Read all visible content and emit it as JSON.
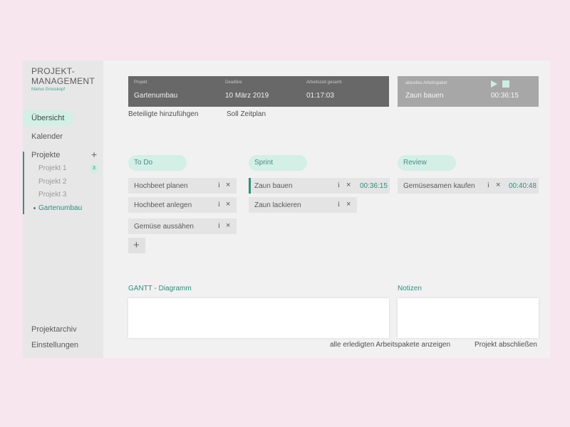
{
  "sidebar": {
    "brand_title": "PROJEKT-\nMANAGEMENT",
    "brand_line1": "PROJEKT-",
    "brand_line2": "MANAGEMENT",
    "brand_sub": "Marius Grosskopf",
    "overview": "Übersicht",
    "calendar": "Kalender",
    "projects": "Projekte",
    "project_items": [
      "Projekt 1",
      "Projekt 2",
      "Projekt 3"
    ],
    "project1_badge": "3",
    "active_project": "Gartenumbau",
    "archive": "Projektarchiv",
    "settings": "Einstellungen"
  },
  "project_info": {
    "project_label": "Projekt",
    "project_value": "Gartenumbau",
    "deadline_label": "Deadline",
    "deadline_value": "10 März 2019",
    "worktime_label": "Arbeitszeit gesamt",
    "worktime_value": "01:17:03"
  },
  "active_package": {
    "label": "aktuelles Arbeitspaket",
    "value": "Zaun bauen",
    "time": "00:36:15"
  },
  "links": {
    "add_participants": "Beteiligte hinzufühgen",
    "target_schedule": "Soll Zeitplan"
  },
  "columns": {
    "todo": {
      "title": "To Do",
      "cards": [
        "Hochbeet planen",
        "Hochbeet anlegen",
        "Gemüse aussähen"
      ]
    },
    "sprint": {
      "title": "Sprint",
      "cards": [
        "Zaun bauen",
        "Zaun lackieren"
      ],
      "active_time": "00:36:15"
    },
    "review": {
      "title": "Review",
      "cards": [
        "Gemüsesamen kaufen"
      ],
      "time": "00:40:48"
    }
  },
  "card_info_symbol": "i",
  "card_close_symbol": "×",
  "add_symbol": "+",
  "gantt_title": "GANTT - Diagramm",
  "notes_title": "Notizen",
  "footer": {
    "show_done": "alle erledigten Arbeitspakete anzeigen",
    "finish_project": "Projekt abschließen"
  },
  "colors": {
    "accent": "#2f8f7b",
    "accent_light": "#d3efe6",
    "background": "#f7e6ee"
  }
}
